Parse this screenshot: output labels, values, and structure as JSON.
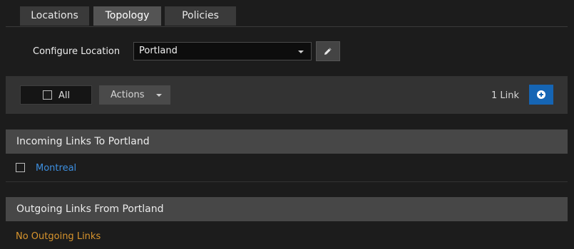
{
  "tabs": [
    {
      "label": "Locations",
      "active": false
    },
    {
      "label": "Topology",
      "active": true
    },
    {
      "label": "Policies",
      "active": false
    }
  ],
  "configure": {
    "label": "Configure Location",
    "selected_location": "Portland",
    "edit_icon": "pencil-icon"
  },
  "toolbar": {
    "select_all_label": "All",
    "actions_label": "Actions",
    "link_count": "1 Link",
    "add_icon": "plus-circle-icon",
    "add_button_color": "#1565b4"
  },
  "incoming": {
    "header": "Incoming Links To Portland",
    "links": [
      {
        "name": "Montreal",
        "checked": false
      }
    ]
  },
  "outgoing": {
    "header": "Outgoing Links From Portland",
    "empty_message": "No Outgoing Links",
    "empty_color": "#d9952d"
  }
}
